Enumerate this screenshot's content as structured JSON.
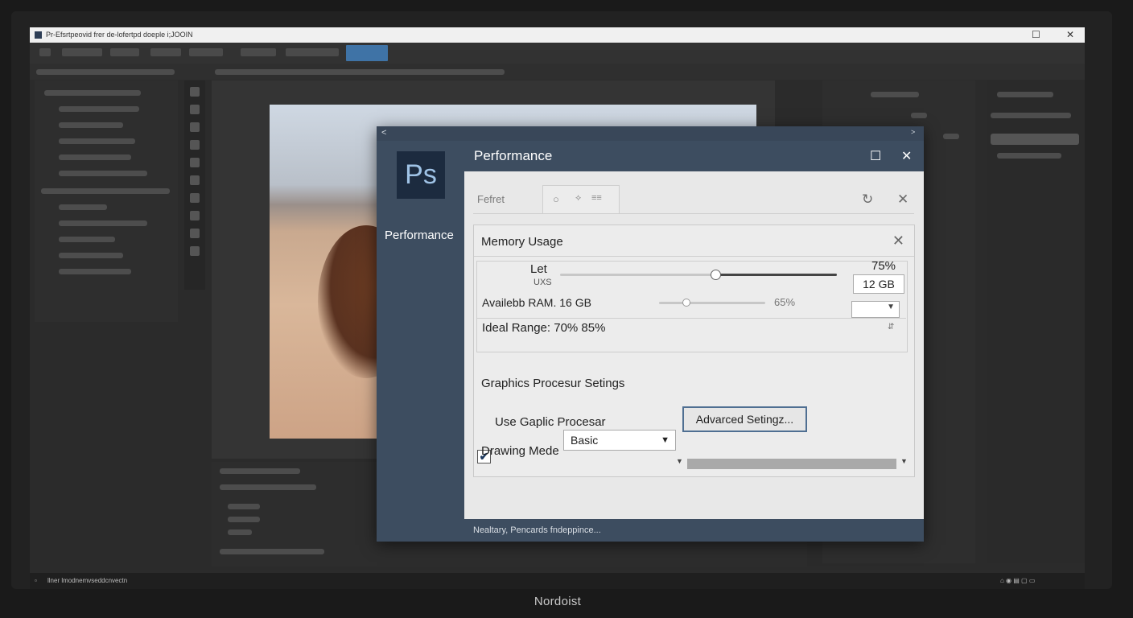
{
  "window": {
    "title": "Pr-Efsrtpeovid frer de-lofertpd doeple i;JOOIN",
    "maximize": "☐",
    "close": "✕"
  },
  "monitor": {
    "brand": "Nordoist"
  },
  "dialog": {
    "logo": "Ps",
    "title": "Performance",
    "maximize": "☐",
    "close": "✕",
    "nav_left": "<",
    "nav_right": ">",
    "sidebar_item": "Performance",
    "tab_label": "Fefret",
    "tab_box_icons": [
      "○",
      "⟡",
      "≡≡"
    ],
    "refresh_icon": "↻",
    "header_close": "✕",
    "footer_text": "Nealtary, Pencards fndeppince...",
    "memory": {
      "title": "Memory Usage",
      "close": "✕",
      "let_label": "Let",
      "let_sub": "UXS",
      "slider1_percent": "75%",
      "slider1_value": 0.75,
      "ram_value": "12 GB",
      "available_label": "Availebb RAM. 16 GB",
      "slider2_percent": "65%",
      "slider2_value": 0.25,
      "ideal_range": "Ideal Range: 70%  85%"
    },
    "graphics": {
      "label": "Graphics Procesur Setings",
      "advanced_button": "Advarced Setingz...",
      "use_gpu_checked": "✔",
      "use_gpu_label": "Use Gaplic Procesar",
      "drawing_mode_label": "Drawing Mede",
      "drawing_mode_value": "Basic"
    }
  },
  "statusbar": {
    "text": "llner  lmodnemvseddcnvectn"
  }
}
